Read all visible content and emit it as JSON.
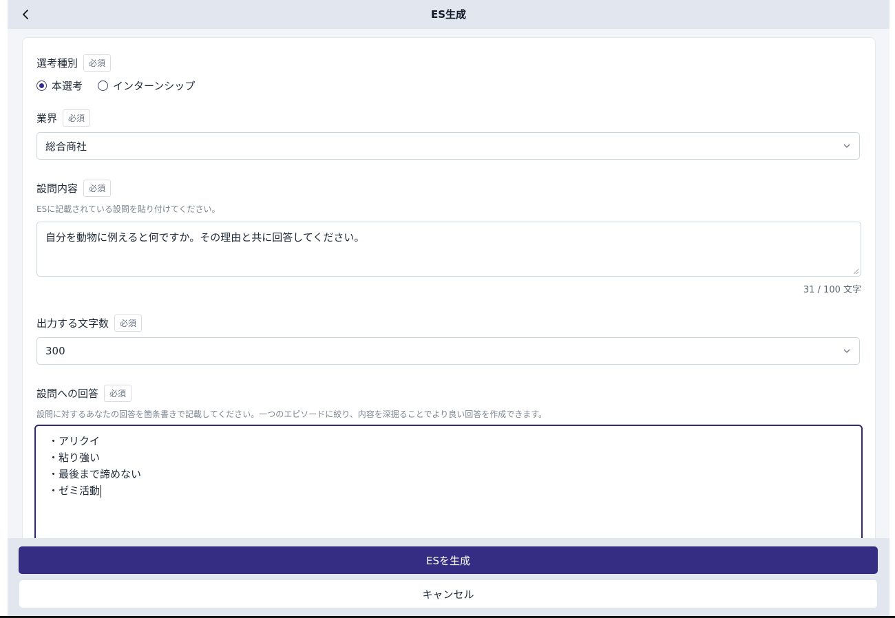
{
  "header": {
    "title": "ES生成",
    "back_icon": "chevron-left-icon"
  },
  "required_badge": "必須",
  "selection_type": {
    "label": "選考種別",
    "options": [
      {
        "label": "本選考",
        "selected": true
      },
      {
        "label": "インターンシップ",
        "selected": false
      }
    ]
  },
  "industry": {
    "label": "業界",
    "value": "総合商社"
  },
  "question": {
    "label": "設問内容",
    "hint": "ESに記載されている設問を貼り付けてください。",
    "value": "自分を動物に例えると何ですか。その理由と共に回答してください。",
    "counter": "31 / 100 文字"
  },
  "char_count": {
    "label": "出力する文字数",
    "value": "300"
  },
  "answer": {
    "label": "設問への回答",
    "hint": "設問に対するあなたの回答を箇条書きで記載してください。一つのエピソードに絞り、内容を深掘ることでより良い回答を作成できます。",
    "lines": [
      "・アリクイ",
      "・粘り強い",
      "・最後まで諦めない",
      "・ゼミ活動"
    ]
  },
  "footer": {
    "submit_label": "ESを生成",
    "cancel_label": "キャンセル"
  },
  "colors": {
    "primary": "#352d84",
    "header_bg": "#e2e7ef",
    "page_bg": "#f3f5f9"
  }
}
